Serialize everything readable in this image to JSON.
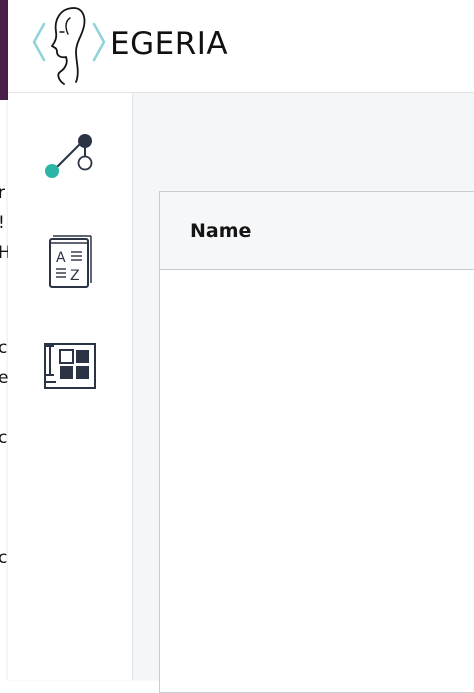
{
  "app": {
    "brand": "EGERIA"
  },
  "background_page": {
    "fragments": [
      "r",
      "!",
      "H",
      "c",
      "e",
      "c",
      "c"
    ]
  },
  "sidebar": {
    "items": [
      {
        "icon": "lineage-graph-icon"
      },
      {
        "icon": "glossary-book-icon"
      },
      {
        "icon": "dashboard-grid-icon"
      }
    ]
  },
  "table": {
    "columns": [
      {
        "label": "Name"
      }
    ],
    "rows": []
  },
  "colors": {
    "accent_teal": "#2bb5a4",
    "logo_chevron": "#8fd3d8",
    "dark_navy": "#2a3445"
  }
}
